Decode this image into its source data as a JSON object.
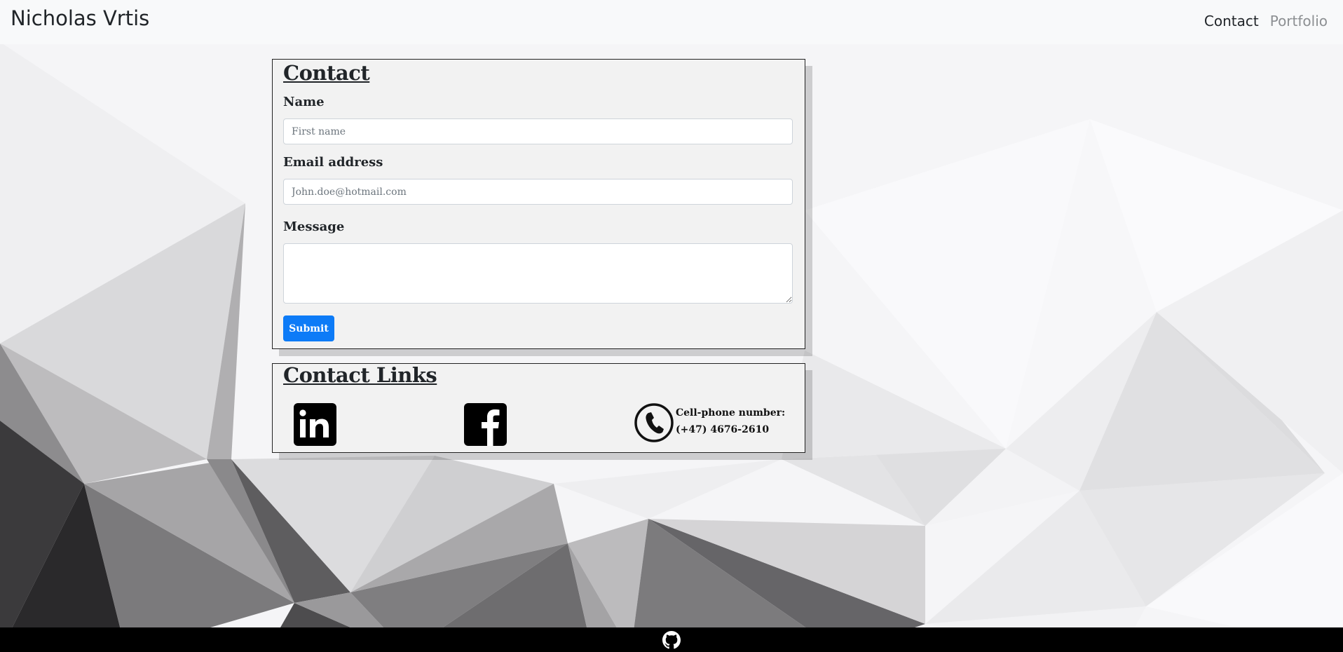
{
  "brand": "Nicholas Vrtis",
  "nav": {
    "contact": "Contact",
    "portfolio": "Portfolio"
  },
  "contact_form": {
    "title": "Contact",
    "name_label": "Name",
    "name_placeholder": "First name",
    "email_label": "Email address",
    "email_placeholder": "John.doe@hotmail.com",
    "message_label": "Message",
    "submit_label": "Submit"
  },
  "contact_links": {
    "title": "Contact Links",
    "phone_label": "Cell-phone number:",
    "phone_number": "(+47) 4676-2610",
    "icons": [
      "linkedin-icon",
      "facebook-icon",
      "phone-icon"
    ]
  },
  "footer": {
    "icons": [
      "github-icon"
    ]
  },
  "colors": {
    "primary": "#0d7bf7",
    "navbar": "#f8f9fa",
    "card": "#f2f2f2",
    "footer": "#000000"
  }
}
